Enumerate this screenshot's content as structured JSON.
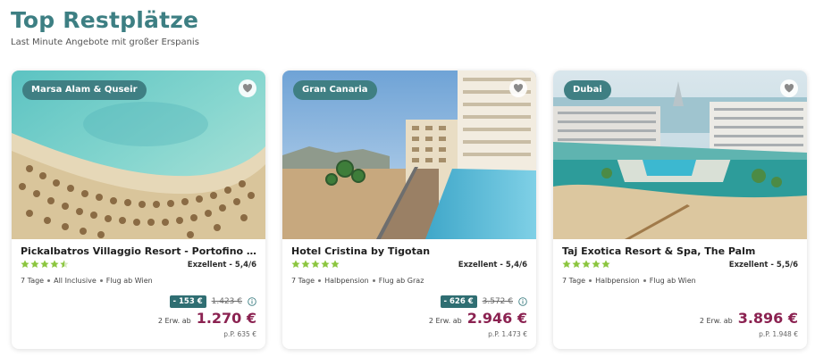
{
  "section": {
    "title": "Top Restplätze",
    "subtitle": "Last Minute Angebote mit großer Erspanis"
  },
  "colors": {
    "accent": "#3f7f83",
    "price": "#8b2251",
    "stars": "#8cc63f"
  },
  "cards": [
    {
      "region": "Marsa Alam & Quseir",
      "image_desc_icon": "beach-aerial-photo",
      "hotel": "Pickalbatros Villaggio Resort - Portofino Marsa Alam",
      "stars": 4.5,
      "rating": "Exzellent - 5,4/6",
      "duration": "7 Tage",
      "board": "All Inclusive",
      "departure": "Flug ab Wien",
      "discount": "- 153 €",
      "old_price": "1.423 €",
      "persons": "2 Erw. ab",
      "price": "1.270 €",
      "per_person": "p.P. 635 €"
    },
    {
      "region": "Gran Canaria",
      "image_desc_icon": "hotel-pool-photo",
      "hotel": "Hotel Cristina by Tigotan",
      "stars": 5,
      "rating": "Exzellent - 5,4/6",
      "duration": "7 Tage",
      "board": "Halbpension",
      "departure": "Flug ab Graz",
      "discount": "- 626 €",
      "old_price": "3.572 €",
      "persons": "2 Erw. ab",
      "price": "2.946 €",
      "per_person": "p.P. 1.473 €"
    },
    {
      "region": "Dubai",
      "image_desc_icon": "resort-aerial-photo",
      "hotel": "Taj Exotica Resort & Spa, The Palm",
      "stars": 5,
      "rating": "Exzellent - 5,5/6",
      "duration": "7 Tage",
      "board": "Halbpension",
      "departure": "Flug ab Wien",
      "persons": "2 Erw. ab",
      "price": "3.896 €",
      "per_person": "p.P. 1.948 €"
    }
  ]
}
